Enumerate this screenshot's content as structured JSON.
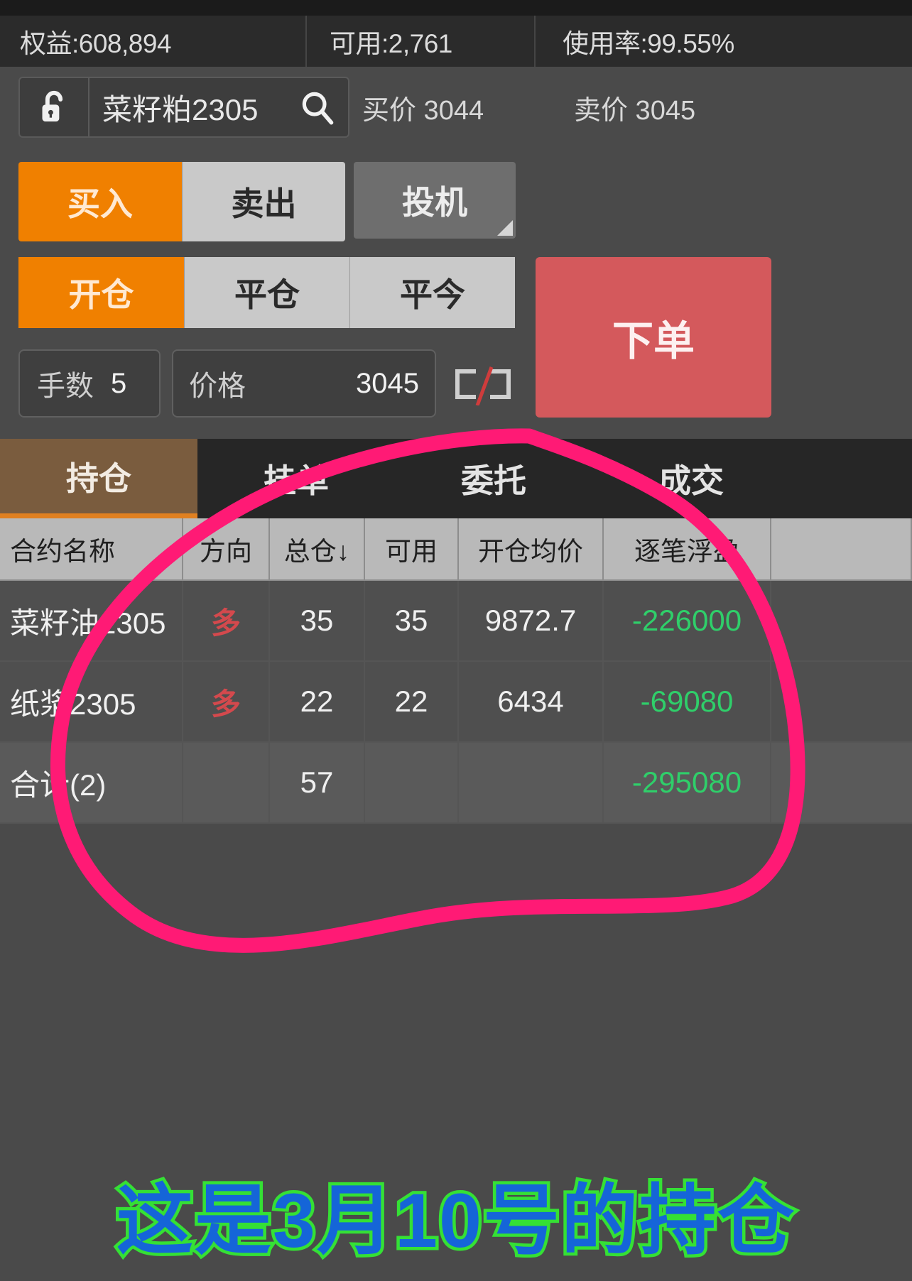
{
  "account": {
    "equity": "权益:608,894",
    "available": "可用:2,761",
    "usage_rate": "使用率:99.55%"
  },
  "contract": {
    "lock_icon": "unlock-icon",
    "name": "菜籽粕2305",
    "search_icon": "search-icon",
    "bid_label": "买价 3044",
    "ask_label": "卖价 3045"
  },
  "direction": {
    "buy": "买入",
    "sell": "卖出",
    "speculation": "投机"
  },
  "offset": {
    "open": "开仓",
    "close": "平仓",
    "close_today": "平今"
  },
  "order": {
    "submit": "下单"
  },
  "inputs": {
    "qty_label": "手数",
    "qty_value": "5",
    "price_label": "价格",
    "price_value": "3045"
  },
  "tabs": [
    {
      "label": "持仓",
      "active": true
    },
    {
      "label": "挂单",
      "active": false
    },
    {
      "label": "委托",
      "active": false
    },
    {
      "label": "成交",
      "active": false
    }
  ],
  "table": {
    "headers": [
      "合约名称",
      "方向",
      "总仓↓",
      "可用",
      "开仓均价",
      "逐笔浮盈",
      ""
    ],
    "rows": [
      {
        "name": "菜籽油2305",
        "direction": "多",
        "total": "35",
        "available": "35",
        "avg_price": "9872.7",
        "pnl": "-226000",
        "extra": ""
      },
      {
        "name": "纸浆2305",
        "direction": "多",
        "total": "22",
        "available": "22",
        "avg_price": "6434",
        "pnl": "-69080",
        "extra": ""
      }
    ],
    "total_row": {
      "name": "合计(2)",
      "direction": "",
      "total": "57",
      "available": "",
      "avg_price": "",
      "pnl": "-295080",
      "extra": ""
    }
  },
  "annotation": {
    "circle_color": "#ff1a75",
    "caption": "这是3月10号的持仓",
    "caption_fill": "#1565d8",
    "caption_stroke": "#35e035"
  },
  "colors": {
    "accent_orange": "#f08000",
    "order_red": "#d4595c",
    "profit_green": "#2fcf6a",
    "long_red": "#d4494d",
    "tab_active": "#7a5c3e"
  }
}
